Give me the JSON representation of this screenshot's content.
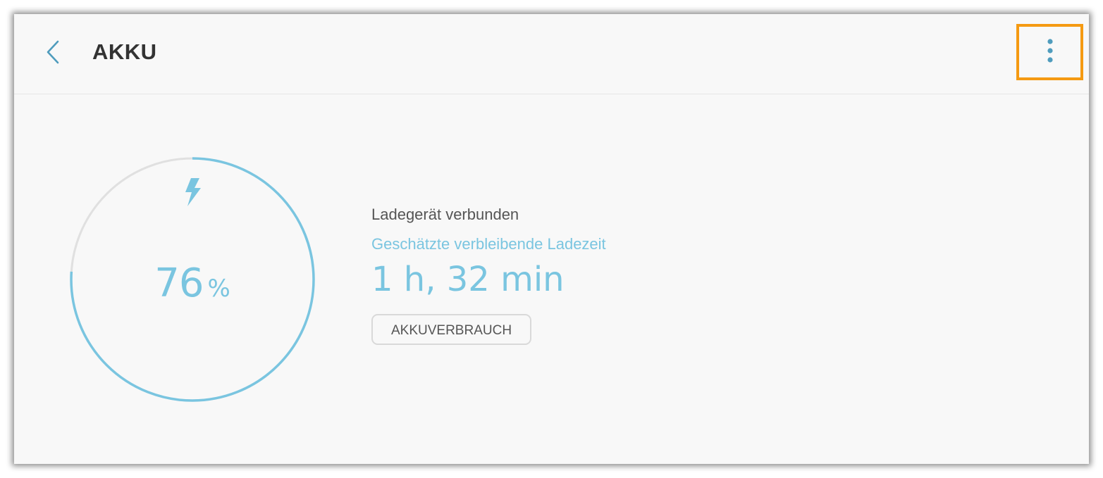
{
  "header": {
    "title": "AKKU",
    "back_icon": "chevron-left-icon",
    "more_icon": "more-vertical-icon"
  },
  "battery": {
    "level_percent": 76,
    "level_label": "76",
    "unit": "%",
    "charging_icon": "lightning-bolt-icon",
    "status": "Ladegerät verbunden",
    "estimate_label": "Geschätzte verbleibende Ladezeit",
    "estimate_value": "1 h, 32 min"
  },
  "actions": {
    "usage_button": "AKKUVERBRAUCH"
  },
  "colors": {
    "accent": "#7ac5e0",
    "track": "#e0e0e0",
    "highlight": "#f59a12",
    "background": "#f8f8f8"
  }
}
